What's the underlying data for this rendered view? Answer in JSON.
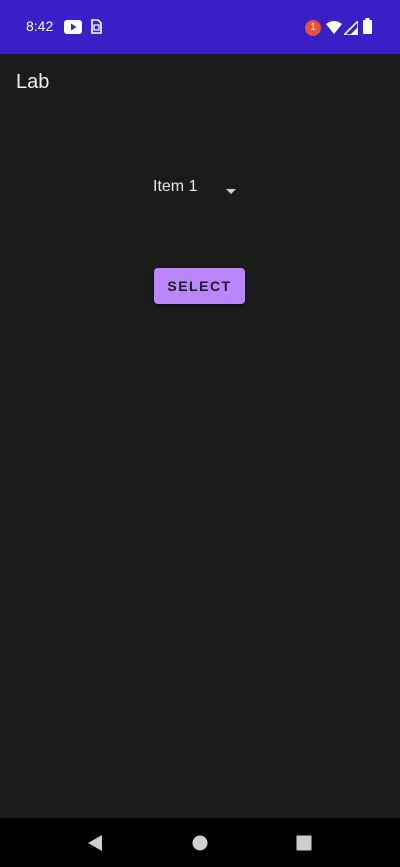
{
  "status_bar": {
    "time": "8:42",
    "notification_count": "1",
    "background_color": "#3a1fc8",
    "icons": [
      "youtube-icon",
      "sim-icon",
      "wifi-icon",
      "signal-icon",
      "battery-icon"
    ]
  },
  "app_bar": {
    "title": "Lab"
  },
  "spinner": {
    "selected_value": "Item 1"
  },
  "select_button": {
    "label": "SELECT",
    "color": "#bb86fc"
  },
  "nav_bar": {
    "icons": [
      "back-icon",
      "home-icon",
      "recents-icon"
    ]
  }
}
